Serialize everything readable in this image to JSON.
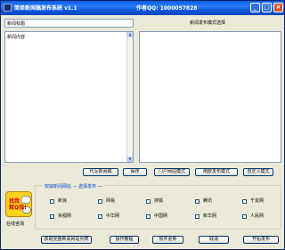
{
  "window": {
    "title": "简单新闻稿发布系统 v1.1",
    "author": "作者QQ: 1000057828",
    "minimize": "_",
    "maximize": "□",
    "close": "×"
  },
  "editor": {
    "title_value": "新闻标题",
    "content_value": "新闻内容"
  },
  "template_panel": {
    "header": "新闻发布模式选择"
  },
  "buttons": {
    "proxy_news": "代写新闻稿",
    "save": "保存",
    "portal_mode": "门户网站模式",
    "nanfang_mode": "南欧发布模式",
    "custom_mode": "自定义模式"
  },
  "sites_group": {
    "title": "权威新闻网站 — 选择发布 —",
    "sites": [
      "新浪",
      "网易",
      "搜狐",
      "腾讯",
      "千龙网",
      "央视网",
      "中华网",
      "中国网",
      "新华网",
      "人民网"
    ]
  },
  "logo": {
    "text_line1": "找我",
    "text_line2": "就Q我!",
    "caption": "在线咨询"
  },
  "footer_buttons": {
    "fetch_sites": "获取完整新闻网站列表",
    "tutorial": "操作教程",
    "update": "软件更新",
    "cancel": "取消",
    "publish": "开始发布"
  },
  "icons": {
    "app": "app-icon",
    "scroll_up": "scroll-up-arrow-icon",
    "scroll_down": "scroll-down-arrow-icon"
  }
}
